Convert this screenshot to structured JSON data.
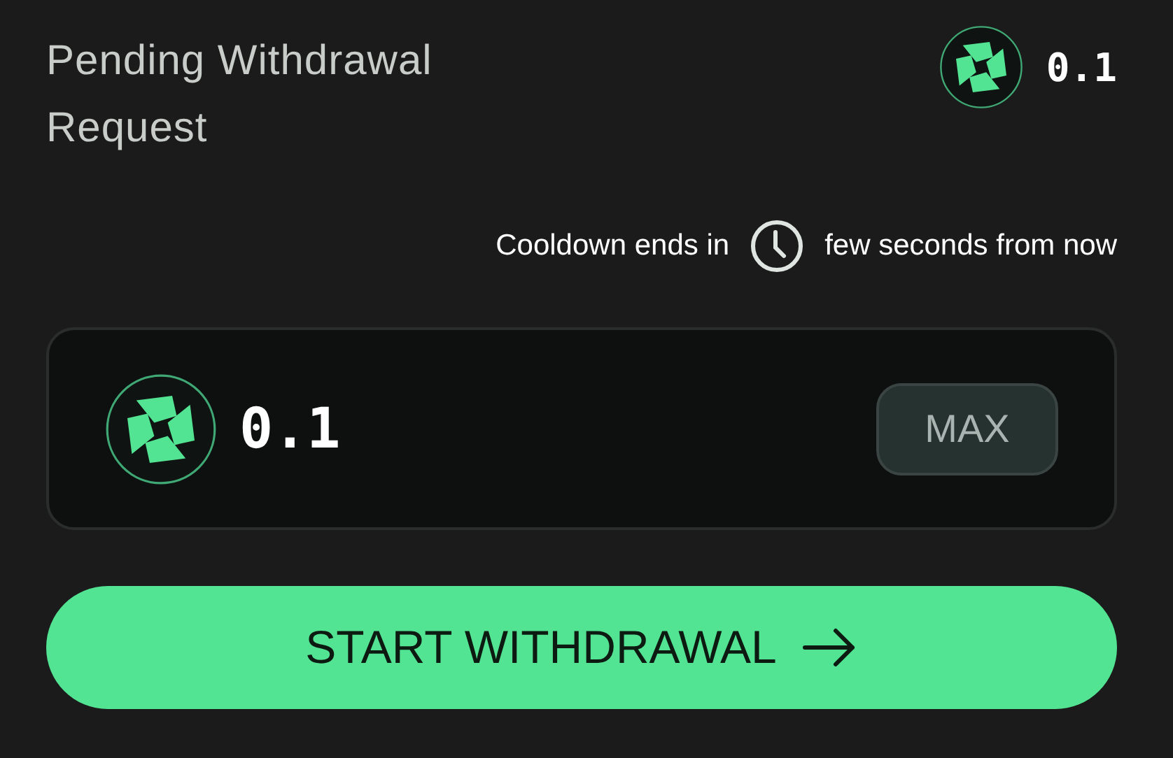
{
  "title": "Pending Withdrawal Request",
  "balance": {
    "amount": "0.1"
  },
  "cooldown": {
    "prefix": "Cooldown ends in",
    "suffix": "few seconds from now"
  },
  "amount_input": {
    "value": "0.1",
    "max_button": "MAX"
  },
  "submit_button": {
    "label": "START WITHDRAWAL"
  }
}
